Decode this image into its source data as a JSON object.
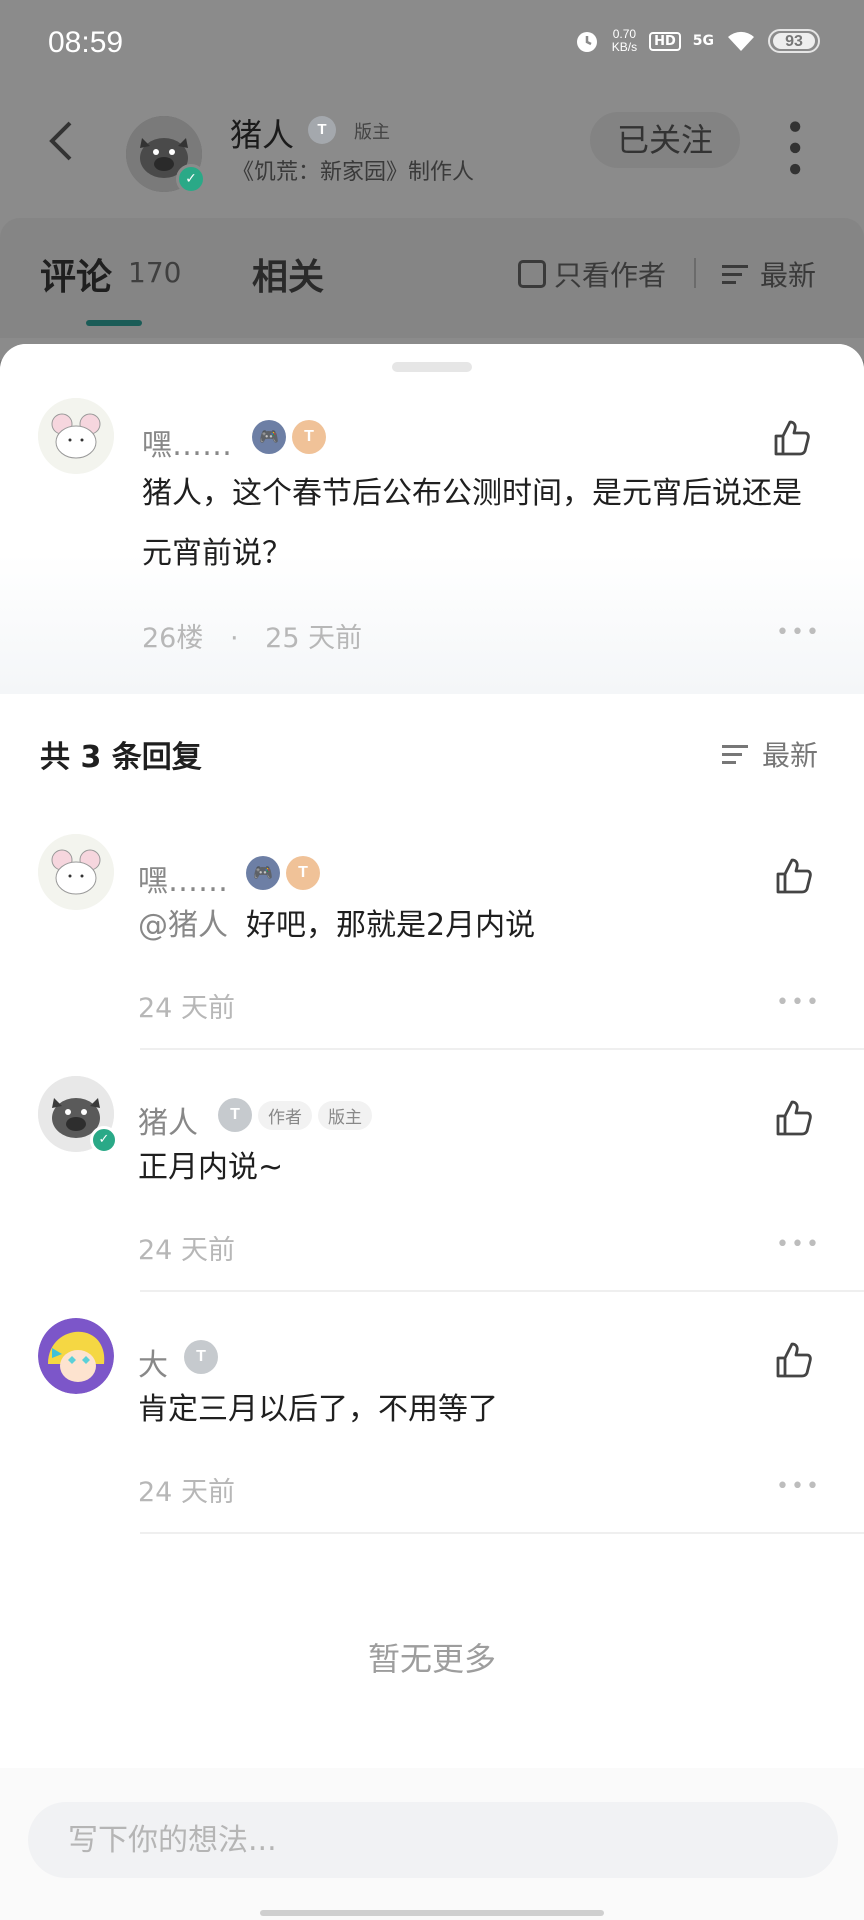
{
  "status": {
    "time": "08:59",
    "net_speed": "0.70",
    "net_unit": "KB/s",
    "hd": "HD",
    "signal": "5G",
    "battery": "93"
  },
  "header": {
    "author_name": "猪人",
    "level": "T",
    "role": "版主",
    "subtitle": "《饥荒：新家园》制作人",
    "follow_label": "已关注"
  },
  "tabs": {
    "comments_label": "评论",
    "comments_count": "170",
    "related_label": "相关",
    "author_only_label": "只看作者",
    "sort_label": "最新"
  },
  "main_comment": {
    "user": "嘿……",
    "text": "猪人，这个春节后公布公测时间，是元宵后说还是元宵前说？",
    "floor": "26楼",
    "sep": "·",
    "time": "25 天前"
  },
  "replies_header": "共 3 条回复",
  "replies_sort": "最新",
  "replies": [
    {
      "user": "嘿……",
      "mention": "@猪人",
      "text": "好吧，那就是2月内说",
      "time": "24 天前"
    },
    {
      "user": "猪人",
      "tag_author": "作者",
      "tag_mod": "版主",
      "text": "正月内说~",
      "time": "24 天前"
    },
    {
      "user": "大",
      "text": "肯定三月以后了，不用等了",
      "time": "24 天前"
    }
  ],
  "no_more": "暂无更多",
  "input": {
    "placeholder": "写下你的想法..."
  },
  "icons": [
    "alarm-icon",
    "wifi-icon",
    "back-icon",
    "verified-icon",
    "more-vertical-icon",
    "sort-icon",
    "like-icon",
    "more-horizontal-icon"
  ],
  "colors": {
    "accent": "#1b5c57",
    "verified": "#2aa987",
    "game_badge": "#6d7fa5",
    "coin_badge": "#f0c298"
  }
}
